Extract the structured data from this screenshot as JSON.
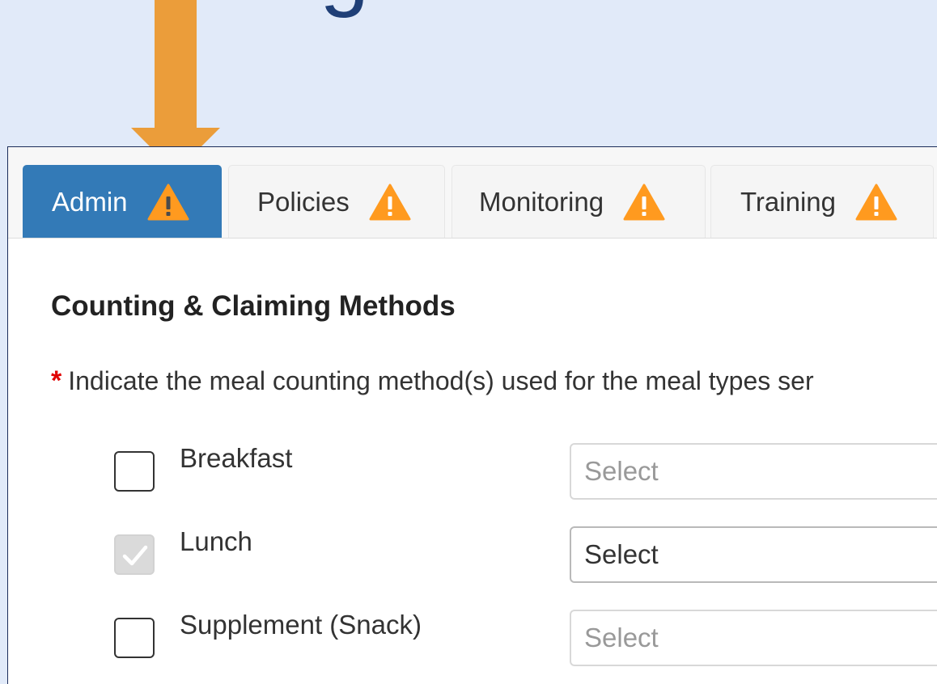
{
  "slide": {
    "title_fragment": "g"
  },
  "colors": {
    "slide_background": "#e1eaf9",
    "arrow": "#eb9d3a",
    "active_tab": "#337ab7",
    "warning": "#ff9a1f",
    "required": "#e00000"
  },
  "tabs": [
    {
      "label": "Admin",
      "active": true,
      "icon": "warning-icon"
    },
    {
      "label": "Policies",
      "active": false,
      "icon": "warning-icon"
    },
    {
      "label": "Monitoring",
      "active": false,
      "icon": "warning-icon"
    },
    {
      "label": "Training",
      "active": false,
      "icon": "warning-icon"
    }
  ],
  "section": {
    "heading": "Counting & Claiming Methods",
    "required_marker": "*",
    "instruction": "Indicate the meal counting method(s) used for the meal types ser"
  },
  "meals": [
    {
      "label": "Breakfast",
      "checked": false,
      "disabled": false,
      "select_value": "Select"
    },
    {
      "label": "Lunch",
      "checked": true,
      "disabled": true,
      "select_value": "Select"
    },
    {
      "label": "Supplement (Snack)",
      "checked": false,
      "disabled": false,
      "select_value": "Select"
    }
  ]
}
